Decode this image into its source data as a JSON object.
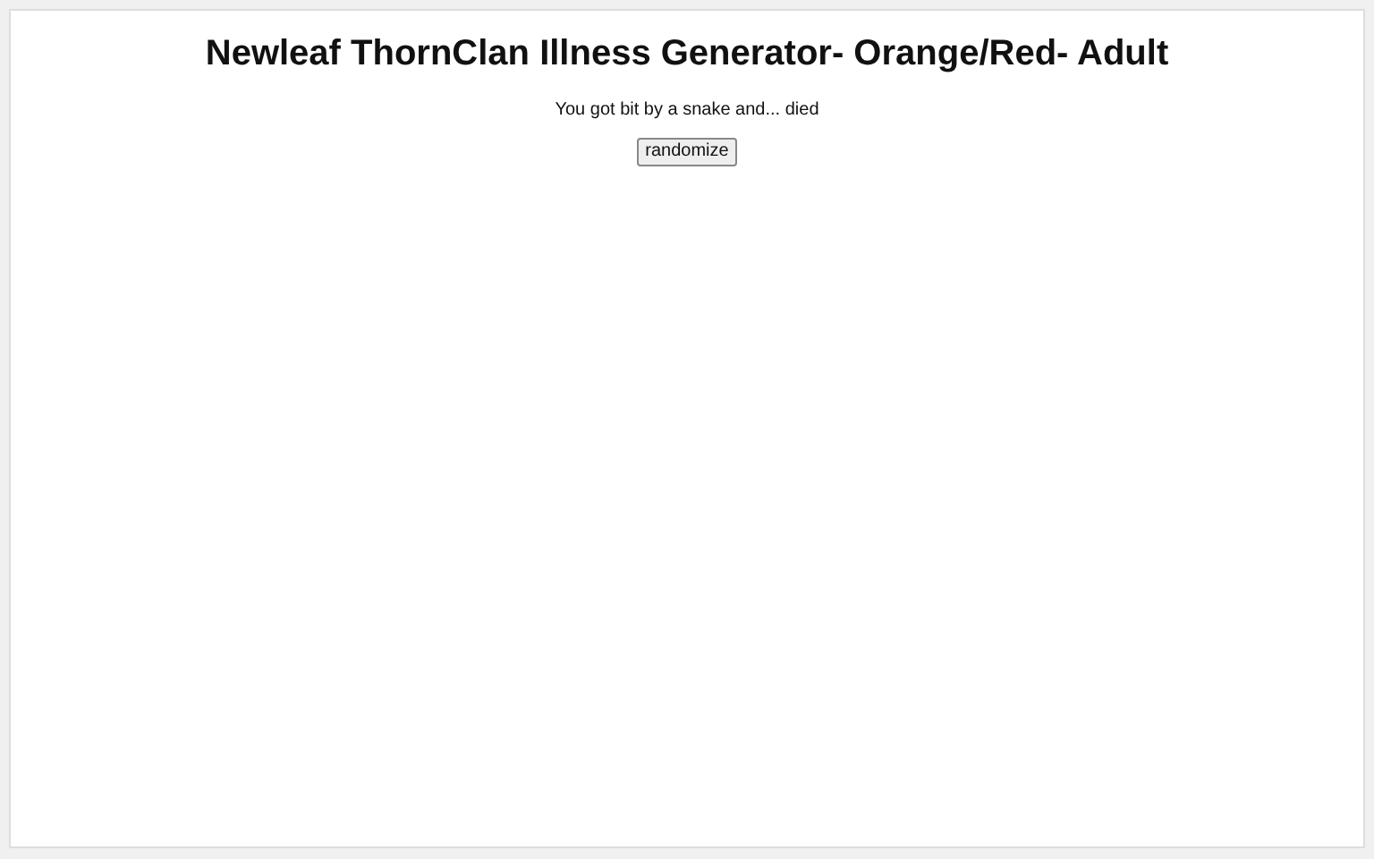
{
  "title": "Newleaf ThornClan Illness Generator- Orange/Red- Adult",
  "result": "You got bit by a snake and... died",
  "button": "randomize"
}
